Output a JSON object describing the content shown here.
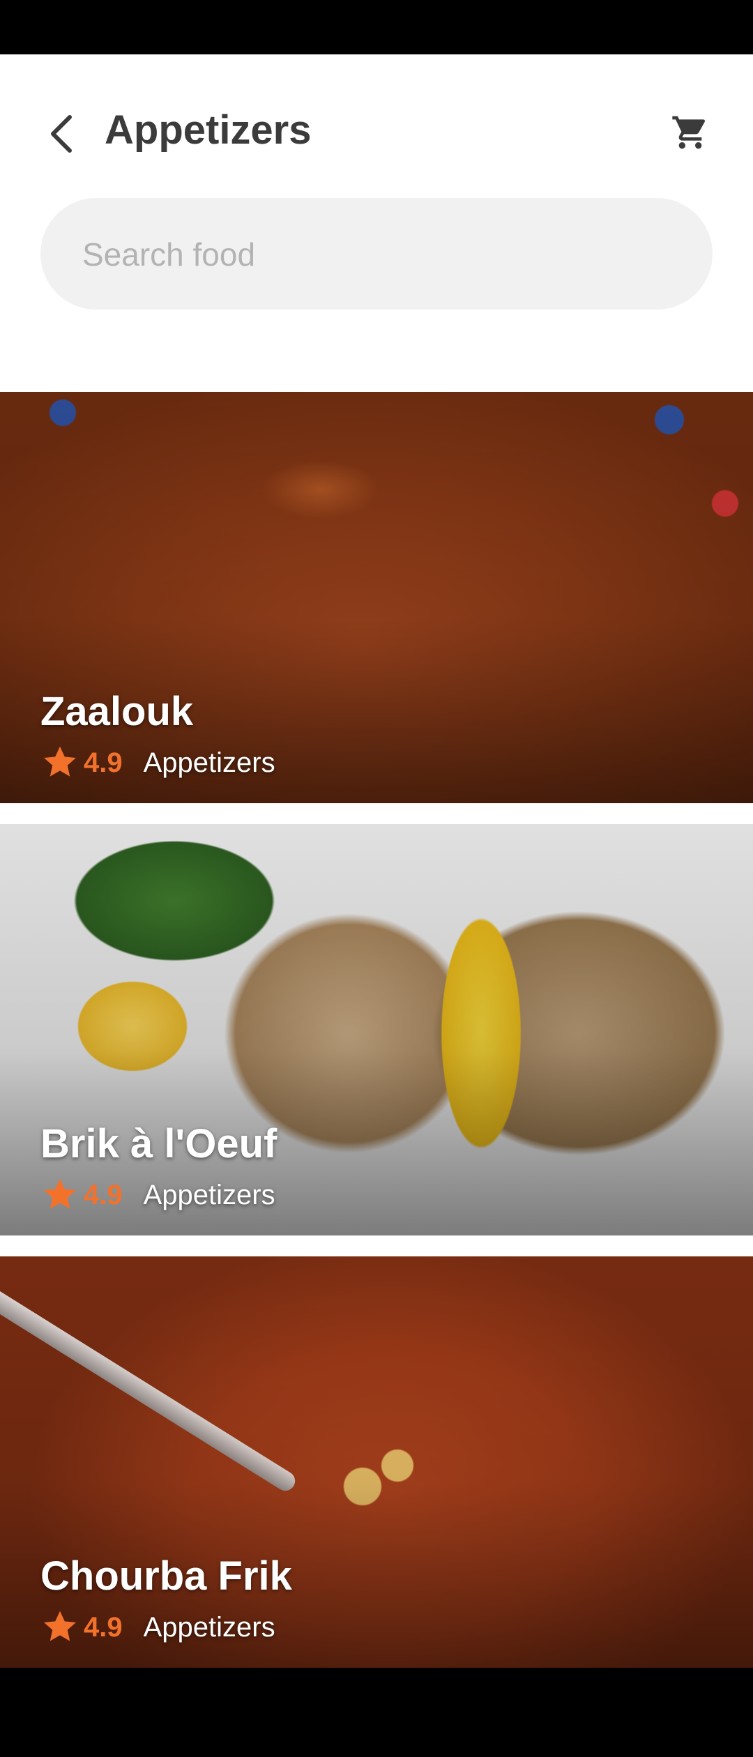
{
  "header": {
    "title": "Appetizers",
    "back_icon": "back-arrow-icon",
    "cart_icon": "cart-icon"
  },
  "search": {
    "placeholder": "Search food",
    "value": ""
  },
  "foods": [
    {
      "name": "Zaalouk",
      "rating": "4.9",
      "category": "Appetizers"
    },
    {
      "name": "Brik à l'Oeuf",
      "rating": "4.9",
      "category": "Appetizers"
    },
    {
      "name": "Chourba Frik",
      "rating": "4.9",
      "category": "Appetizers"
    }
  ],
  "colors": {
    "accent": "#f2722c",
    "title_text": "#3b3b3b",
    "search_bg": "#f1f1f1",
    "placeholder": "#b3b3b3"
  }
}
